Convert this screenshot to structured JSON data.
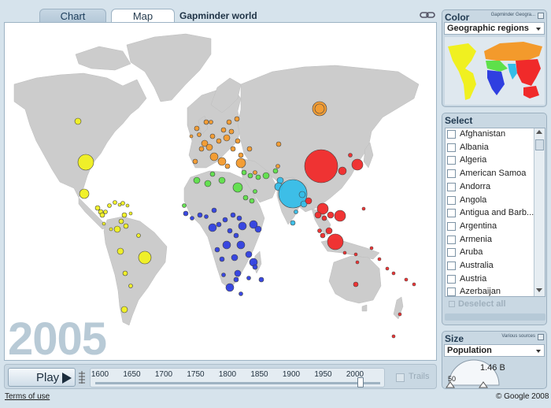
{
  "tabs": {
    "chart": "Chart",
    "map": "Map"
  },
  "title": "Gapminder world",
  "year": "2005",
  "playback": {
    "play_label": "Play",
    "timeline_ticks": [
      "1600",
      "1650",
      "1700",
      "1750",
      "1800",
      "1850",
      "1900",
      "1950",
      "2000"
    ],
    "current_year_fraction": 0.93,
    "trails_label": "Trails"
  },
  "footer": {
    "terms": "Terms of use",
    "copyright": "© Google 2008"
  },
  "color_panel": {
    "title": "Color",
    "source": "Gapminder Geogra...",
    "selected": "Geographic regions"
  },
  "select_panel": {
    "title": "Select",
    "countries": [
      "Afghanistan",
      "Albania",
      "Algeria",
      "American Samoa",
      "Andorra",
      "Angola",
      "Antigua and Barb...",
      "Argentina",
      "Armenia",
      "Aruba",
      "Australia",
      "Austria",
      "Azerbaijan"
    ],
    "deselect_all": "Deselect all"
  },
  "size_panel": {
    "title": "Size",
    "source": "Various sources",
    "selected": "Population",
    "dial_min": "50",
    "dial_value": "1.46 B"
  },
  "colors": {
    "americas": "#f0f020",
    "europe_central_asia": "#f39a2c",
    "sub_saharan_africa": "#2f3fe0",
    "middle_east_north_africa": "#5ee04a",
    "south_asia": "#35bde8",
    "east_asia_pacific": "#f02a2a",
    "land": "#cccccc"
  }
}
